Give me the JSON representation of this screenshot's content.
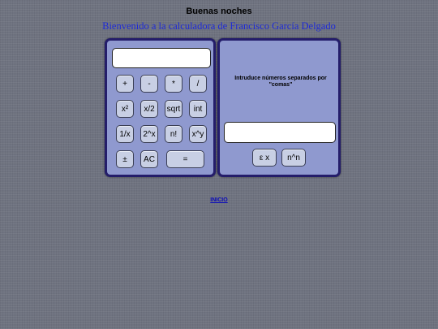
{
  "header": {
    "greeting": "Buenas noches",
    "welcome": "Bienvenido a la calculadora de Francisco García Delgado"
  },
  "calculator": {
    "display_value": "",
    "buttons": {
      "plus": "+",
      "minus": "-",
      "multiply": "*",
      "divide": "/",
      "square": "x²",
      "half": "x/2",
      "sqrt": "sqrt",
      "int": "int",
      "reciprocal": "1/x",
      "pow2": "2^x",
      "factorial": "n!",
      "power": "x^y",
      "sign": "±",
      "clear": "AC",
      "equals": "="
    }
  },
  "list_panel": {
    "instruction": "Intruduce números separados por \"comas\"",
    "input_value": "",
    "sum_label": "ε x",
    "pow_label": "n^n"
  },
  "footer": {
    "link_label": "INICIO"
  }
}
